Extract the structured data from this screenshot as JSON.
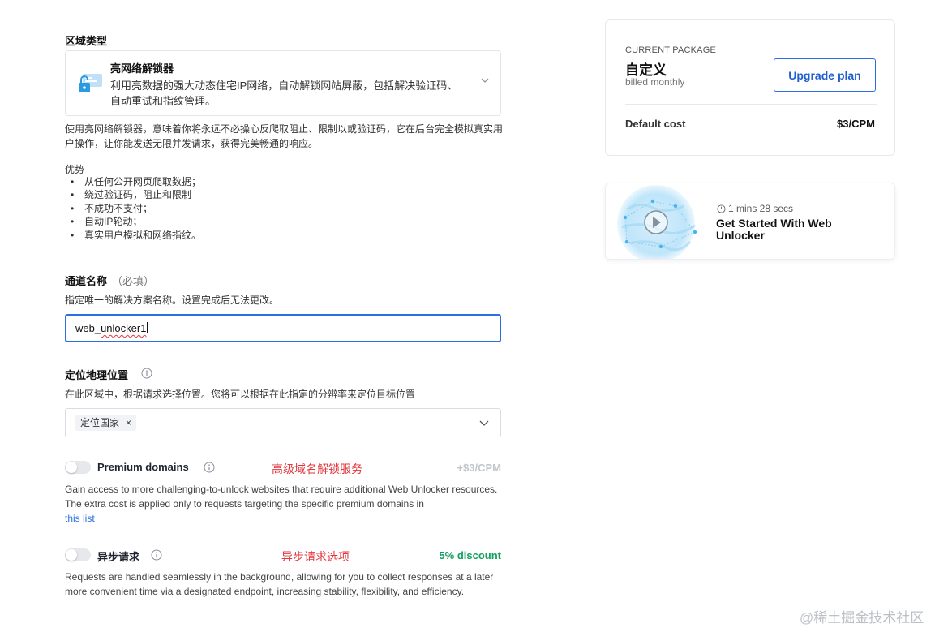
{
  "zone_type": {
    "label": "区域类型",
    "selected_title": "亮网络解锁器",
    "selected_desc": "利用亮数据的强大动态住宅IP网络，自动解锁网站屏蔽，包括解决验证码、自动重试和指纹管理。",
    "icon": "unlocker-icon"
  },
  "description": "使用亮网络解锁器，意味着你将永远不必操心反爬取阻止、限制以或验证码，它在后台完全模拟真实用户操作，让你能发送无限并发请求，获得完美畅通的响应。",
  "advantages": {
    "title": "优势",
    "items": [
      "从任何公开网页爬取数据；",
      "绕过验证码，阻止和限制",
      "不成功不支付；",
      "自动IP轮动；",
      "真实用户模拟和网络指纹。"
    ]
  },
  "channel": {
    "label": "通道名称",
    "required": "（必填）",
    "hint": "指定唯一的解决方案名称。设置完成后无法更改。",
    "value_prefix": "web_",
    "value_misspelled": "unlocker1"
  },
  "geo": {
    "label": "定位地理位置",
    "hint": "在此区域中，根据请求选择位置。您将可以根据在此指定的分辨率来定位目标位置",
    "chip": "定位国家",
    "chip_remove": "×"
  },
  "premium": {
    "title": "Premium domains",
    "annotation": "高级域名解锁服务",
    "price": "+$3/CPM",
    "desc": "Gain access to more challenging-to-unlock websites that require additional Web Unlocker resources. The extra cost is applied only to requests targeting the specific premium domains in",
    "link": "this list",
    "enabled": false
  },
  "async": {
    "title": "异步请求",
    "annotation": "异步请求选项",
    "price": "5% discount",
    "desc": "Requests are handled seamlessly in the background, allowing for you to collect responses at a later more convenient time via a designated endpoint, increasing stability, flexibility, and efficiency.",
    "enabled": false
  },
  "package": {
    "label": "CURRENT PACKAGE",
    "name": "自定义",
    "billing": "billed monthly",
    "upgrade": "Upgrade plan",
    "cost_label": "Default cost",
    "cost_value": "$3/CPM"
  },
  "video": {
    "duration": "1 mins 28 secs",
    "title": "Get Started With Web Unlocker"
  },
  "watermark": "@稀土掘金技术社区",
  "colors": {
    "accent": "#2c6fe0",
    "annotation_red": "#e0383e",
    "discount_green": "#12a05c"
  }
}
